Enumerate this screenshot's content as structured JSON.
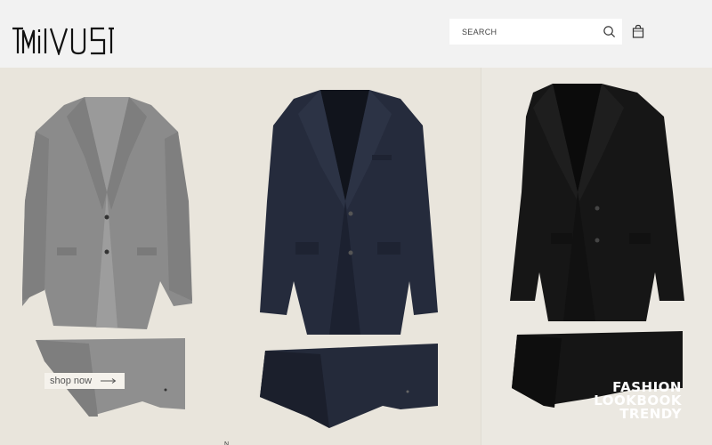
{
  "brand": {
    "logo_text": "MilVUS"
  },
  "search": {
    "placeholder": "SEARCH"
  },
  "icons": {
    "search": "search-icon",
    "cart": "shopping-bag-icon"
  },
  "hero": {
    "cta_label": "shop now",
    "lookbook_lines": [
      "FASHION",
      "LOOKBOOK",
      "TRENDY"
    ]
  },
  "products": [
    {
      "name": "grey-suit",
      "color": "#8a8a8a"
    },
    {
      "name": "navy-suit",
      "color": "#242a3b"
    },
    {
      "name": "black-suit",
      "color": "#161616"
    }
  ],
  "footer_fragment": "N"
}
